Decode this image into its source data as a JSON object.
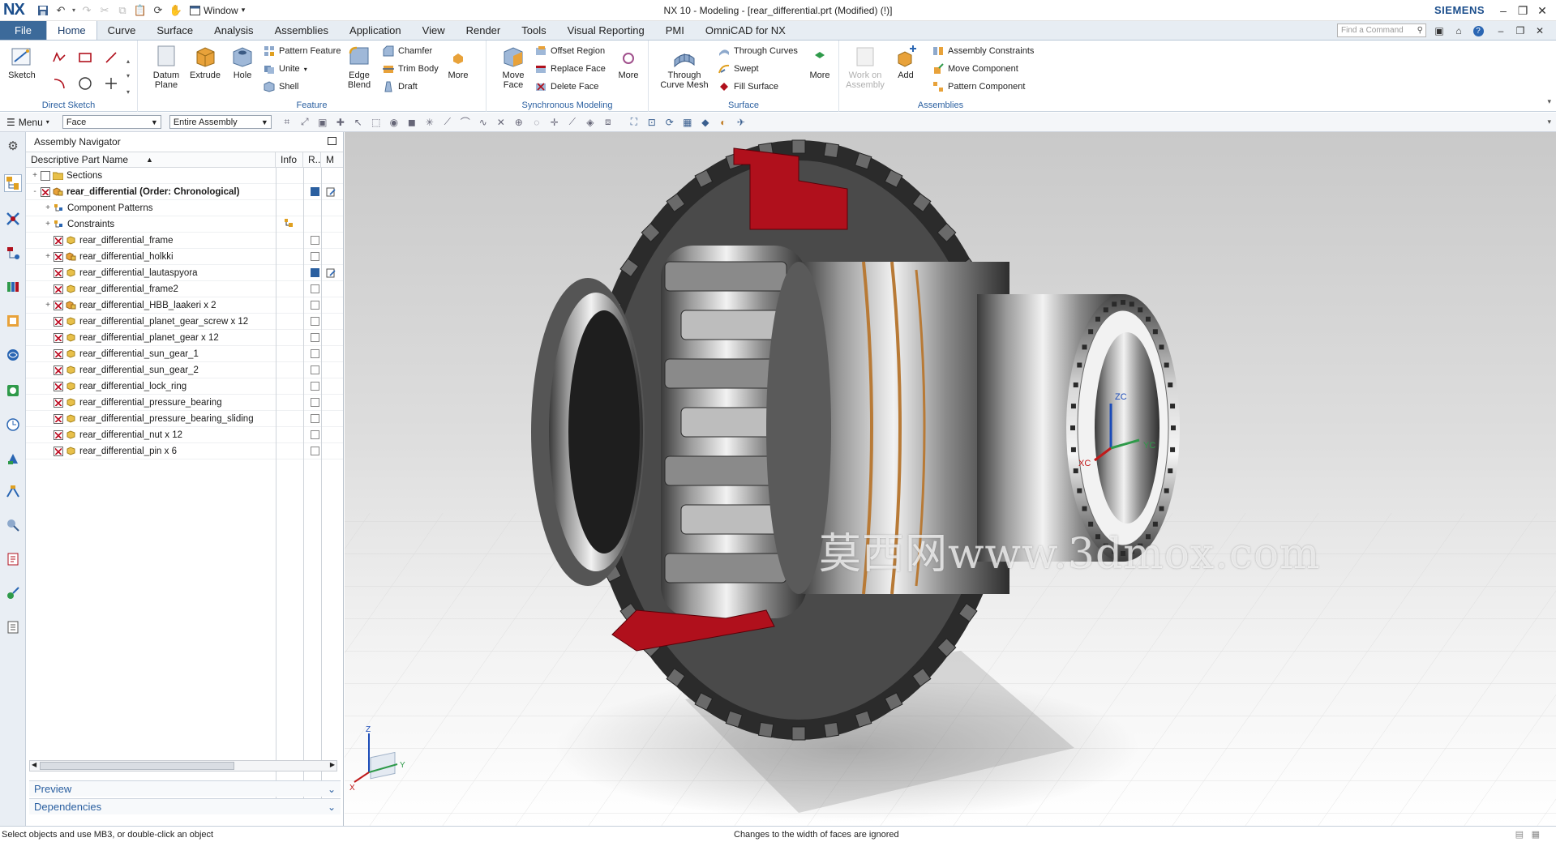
{
  "window": {
    "logo": "NX",
    "title": "NX 10 - Modeling - [rear_differential.prt (Modified)   (!)]",
    "window_menu": "Window",
    "brand": "SIEMENS"
  },
  "tabs": [
    "File",
    "Home",
    "Curve",
    "Surface",
    "Analysis",
    "Assemblies",
    "Application",
    "View",
    "Render",
    "Tools",
    "Visual Reporting",
    "PMI",
    "OmniCAD for NX"
  ],
  "active_tab": "Home",
  "search": {
    "placeholder": "Find a Command"
  },
  "ribbon": {
    "direct_sketch": {
      "sketch": "Sketch",
      "label": "Direct Sketch"
    },
    "feature": {
      "datum_plane": "Datum Plane",
      "extrude": "Extrude",
      "hole": "Hole",
      "pattern_feature": "Pattern Feature",
      "unite": "Unite",
      "shell": "Shell",
      "edge_blend": "Edge Blend",
      "chamfer": "Chamfer",
      "trim_body": "Trim Body",
      "draft": "Draft",
      "more": "More",
      "label": "Feature"
    },
    "synchronous": {
      "move_face": "Move Face",
      "offset_region": "Offset Region",
      "replace_face": "Replace Face",
      "delete_face": "Delete Face",
      "more": "More",
      "label": "Synchronous Modeling"
    },
    "surface": {
      "through_curve_mesh": "Through Curve Mesh",
      "through_curves": "Through Curves",
      "swept": "Swept",
      "fill_surface": "Fill Surface",
      "more": "More",
      "label": "Surface"
    },
    "assemblies": {
      "work_on_assembly": "Work on Assembly",
      "add": "Add",
      "assembly_constraints": "Assembly Constraints",
      "move_component": "Move Component",
      "pattern_component": "Pattern Component",
      "label": "Assemblies"
    }
  },
  "toolbar": {
    "menu": "Menu",
    "filter": "Face",
    "scope": "Entire Assembly"
  },
  "navigator": {
    "title": "Assembly Navigator",
    "columns": [
      "Descriptive Part Name",
      "Info",
      "R..",
      "M"
    ],
    "rows": [
      {
        "name": "Sections",
        "level": 0,
        "expand": "+",
        "checked": false,
        "bold": false,
        "icon": "folder-icon"
      },
      {
        "name": "rear_differential (Order: Chronological)",
        "level": 0,
        "expand": "-",
        "checked": true,
        "bold": true,
        "icon": "assembly-icon"
      },
      {
        "name": "Component Patterns",
        "level": 1,
        "expand": "+",
        "checked": null,
        "bold": false,
        "icon": "pattern-icon"
      },
      {
        "name": "Constraints",
        "level": 1,
        "expand": "+",
        "checked": null,
        "bold": false,
        "icon": "constraint-icon"
      },
      {
        "name": "rear_differential_frame",
        "level": 1,
        "expand": "",
        "checked": true,
        "bold": false,
        "icon": "part-icon"
      },
      {
        "name": "rear_differential_holkki",
        "level": 1,
        "expand": "+",
        "checked": true,
        "bold": false,
        "icon": "subassembly-icon"
      },
      {
        "name": "rear_differential_lautaspyora",
        "level": 1,
        "expand": "",
        "checked": true,
        "bold": false,
        "icon": "part-icon"
      },
      {
        "name": "rear_differential_frame2",
        "level": 1,
        "expand": "",
        "checked": true,
        "bold": false,
        "icon": "part-icon"
      },
      {
        "name": "rear_differential_HBB_laakeri x 2",
        "level": 1,
        "expand": "+",
        "checked": true,
        "bold": false,
        "icon": "subassembly-icon"
      },
      {
        "name": "rear_differential_planet_gear_screw x 12",
        "level": 1,
        "expand": "",
        "checked": true,
        "bold": false,
        "icon": "part-icon"
      },
      {
        "name": "rear_differential_planet_gear x 12",
        "level": 1,
        "expand": "",
        "checked": true,
        "bold": false,
        "icon": "part-icon"
      },
      {
        "name": "rear_differential_sun_gear_1",
        "level": 1,
        "expand": "",
        "checked": true,
        "bold": false,
        "icon": "part-icon"
      },
      {
        "name": "rear_differential_sun_gear_2",
        "level": 1,
        "expand": "",
        "checked": true,
        "bold": false,
        "icon": "part-icon"
      },
      {
        "name": "rear_differential_lock_ring",
        "level": 1,
        "expand": "",
        "checked": true,
        "bold": false,
        "icon": "part-icon"
      },
      {
        "name": "rear_differential_pressure_bearing",
        "level": 1,
        "expand": "",
        "checked": true,
        "bold": false,
        "icon": "part-icon"
      },
      {
        "name": "rear_differential_pressure_bearing_sliding",
        "level": 1,
        "expand": "",
        "checked": true,
        "bold": false,
        "icon": "part-icon"
      },
      {
        "name": "rear_differential_nut x 12",
        "level": 1,
        "expand": "",
        "checked": true,
        "bold": false,
        "icon": "part-icon"
      },
      {
        "name": "rear_differential_pin x 6",
        "level": 1,
        "expand": "",
        "checked": true,
        "bold": false,
        "icon": "part-icon"
      }
    ],
    "preview": "Preview",
    "dependencies": "Dependencies"
  },
  "viewport": {
    "watermark": "莫西网www.3dmox.com",
    "triad": {
      "x": "X",
      "y": "Y",
      "z": "Z"
    },
    "csys": {
      "xc": "XC",
      "yc": "YC",
      "zc": "ZC"
    }
  },
  "status": {
    "left": "Select objects and use MB3, or double-click an object",
    "center": "Changes to the width of faces are ignored"
  },
  "colors": {
    "accent": "#2a5fa0",
    "file_tab": "#3c6a9a",
    "section_red": "#b0101c",
    "brass": "#b87a36"
  }
}
